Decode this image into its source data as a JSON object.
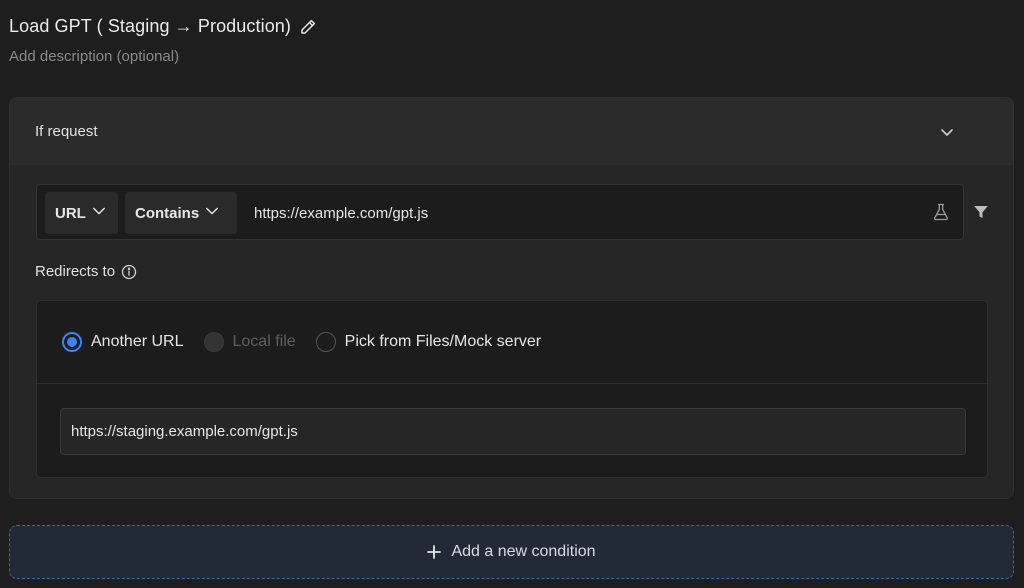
{
  "rule": {
    "title": "Load GPT ( Staging → Production)",
    "description_placeholder": "Add description (optional)"
  },
  "condition": {
    "header_title": "If request",
    "source_type": "URL",
    "operator": "Contains",
    "source_value": "https://example.com/gpt.js"
  },
  "redirect": {
    "label": "Redirects to",
    "options": [
      {
        "label": "Another URL",
        "selected": true,
        "disabled": false
      },
      {
        "label": "Local file",
        "selected": false,
        "disabled": true
      },
      {
        "label": "Pick from Files/Mock server",
        "selected": false,
        "disabled": false
      }
    ],
    "destination": "https://staging.example.com/gpt.js"
  },
  "actions": {
    "add_condition_label": "Add a new condition"
  },
  "colors": {
    "accent": "#3b82f6",
    "background": "#1e1e1e",
    "card": "#262626"
  }
}
